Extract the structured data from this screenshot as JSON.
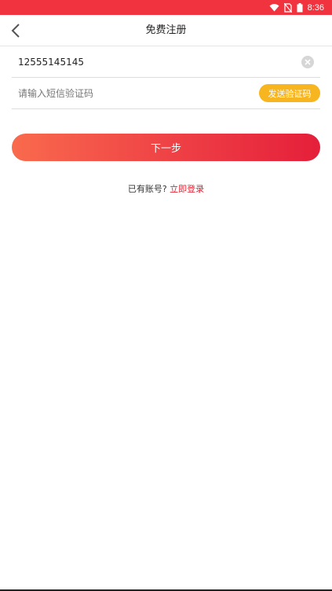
{
  "status_bar": {
    "time": "8:36",
    "icons": [
      "wifi-icon",
      "no-sim-icon",
      "battery-icon"
    ],
    "background": "#f0333f"
  },
  "header": {
    "title": "免费注册",
    "back_icon": "chevron-left-icon"
  },
  "form": {
    "phone": {
      "value": "12555145145",
      "clear_icon": "clear-icon"
    },
    "code": {
      "value": "",
      "placeholder": "请输入短信验证码",
      "send_label": "发送验证码"
    }
  },
  "next_button": {
    "label": "下一步"
  },
  "login_prompt": {
    "text": "已有账号?",
    "link": "立即登录"
  },
  "colors": {
    "accent": "#e51f3a",
    "send_button": "#f7b520",
    "link": "#e21f2f"
  }
}
